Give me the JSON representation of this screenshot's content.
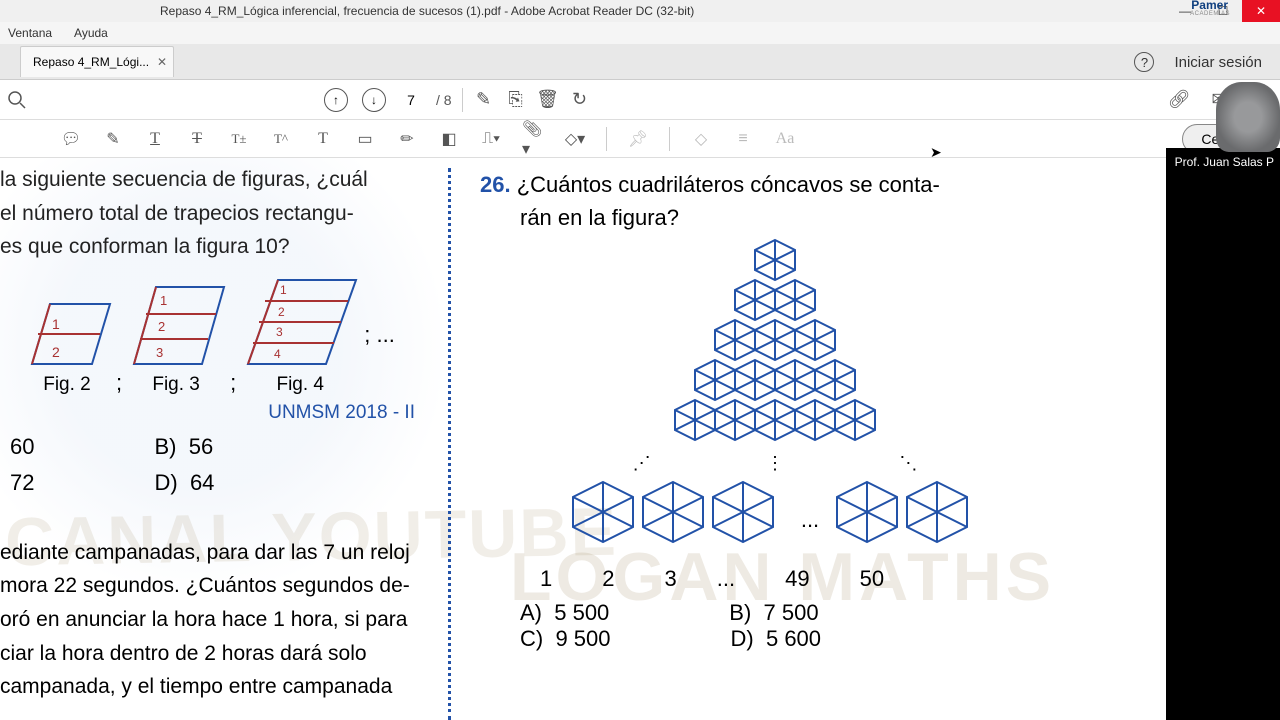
{
  "window": {
    "title": "Repaso 4_RM_Lógica inferencial, frecuencia de sucesos (1).pdf - Adobe Acrobat Reader DC (32-bit)",
    "brand": "Pamer",
    "brand_sub": "ACADEMIAS"
  },
  "menu": {
    "ventana": "Ventana",
    "ayuda": "Ayuda"
  },
  "tab": {
    "label": "Repaso 4_RM_Lógi..."
  },
  "signin": "Iniciar sesión",
  "page": {
    "current": "7",
    "total": "/ 8"
  },
  "close_btn": "Cerrar",
  "prof": "Prof. Juan Salas P",
  "left_question": {
    "line1": "la siguiente secuencia de figuras, ¿cuál",
    "line2": "el número total de trapecios rectangu-",
    "line3": "es que conforman la figura 10?",
    "fig2": "Fig. 2",
    "fig3": "Fig. 3",
    "fig4": "Fig. 4",
    "cont": "; ...",
    "source": "UNMSM 2018 - II",
    "optA": "60",
    "optB_l": "B)",
    "optB": "56",
    "optC": "72",
    "optD_l": "D)",
    "optD": "64"
  },
  "q2": {
    "l1": "ediante campanadas, para dar las 7 un reloj",
    "l2": "mora 22 segundos. ¿Cuántos segundos de-",
    "l3": "oró en anunciar la hora hace 1 hora, si para",
    "l4": "ciar la hora dentro de 2 horas dará solo",
    "l5": "campanada, y el tiempo entre campanada"
  },
  "right_question": {
    "num": "26.",
    "line1": "¿Cuántos cuadriláteros cóncavos se conta-",
    "line2": "rán en la figura?",
    "labels": {
      "n1": "1",
      "n2": "2",
      "n3": "3",
      "dots": "...",
      "n49": "49",
      "n50": "50"
    },
    "ellipsis": "...",
    "optA_l": "A)",
    "optA": "5 500",
    "optB_l": "B)",
    "optB": "7 500",
    "optC_l": "C)",
    "optC": "9 500",
    "optD_l": "D)",
    "optD": "5 600"
  },
  "watermark1": "CANAL YOUTUBE",
  "watermark2": "LOGAN MATHS"
}
